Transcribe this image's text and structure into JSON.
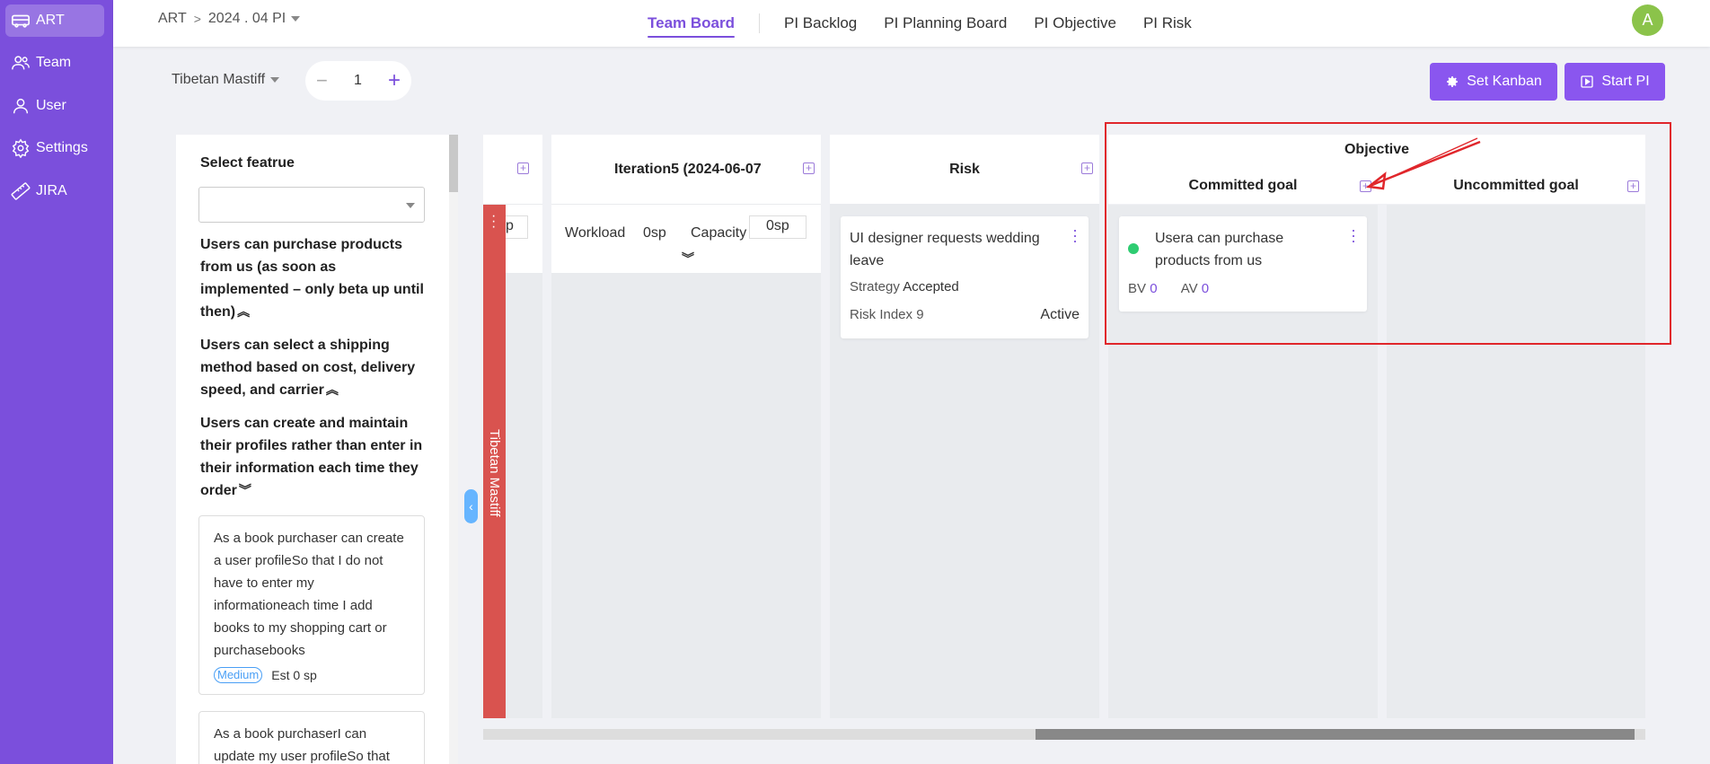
{
  "sidebar": {
    "items": [
      {
        "label": "ART",
        "icon": "bus-icon",
        "active": true
      },
      {
        "label": "Team",
        "icon": "team-icon"
      },
      {
        "label": "User",
        "icon": "user-icon"
      },
      {
        "label": "Settings",
        "icon": "gear-icon"
      },
      {
        "label": "JIRA",
        "icon": "ruler-icon"
      }
    ]
  },
  "header": {
    "breadcrumb_root": "ART",
    "breadcrumb_sep": ">",
    "breadcrumb_pi": "2024 . 04 PI",
    "tabs": [
      {
        "label": "Team Board",
        "active": true
      },
      {
        "label": "PI Backlog"
      },
      {
        "label": "PI Planning Board"
      },
      {
        "label": "PI Objective"
      },
      {
        "label": "PI Risk"
      }
    ],
    "avatar_initial": "A"
  },
  "toolbar": {
    "team": "Tibetan Mastiff",
    "stepper_value": "1",
    "set_kanban_label": "Set Kanban",
    "start_pi_label": "Start PI"
  },
  "features": {
    "select_label": "Select featrue",
    "items": [
      {
        "title": "Users can purchase products from us (as soon as implemented – only beta up until then)",
        "chevron": "︽"
      },
      {
        "title": "Users can select a shipping method based on cost, delivery speed, and carrier",
        "chevron": "︽"
      },
      {
        "title": "Users can create and maintain their profiles rather than enter in their information each time they order",
        "chevron": "︾"
      }
    ],
    "stories": [
      {
        "text": "As a book purchaser can create a user profileSo that I do not have to enter my informationeach time I add books to my shopping cart or purchasebooks",
        "priority": "Medium",
        "estimate": "Est 0 sp"
      },
      {
        "text": "As a book purchaserI can update my user profileSo that"
      }
    ]
  },
  "board": {
    "partial_input": "p",
    "team_band": "Tibetan Mastiff",
    "iteration": {
      "title": "Iteration5 (2024-06-07",
      "workload_label": "Workload",
      "workload_value": "0sp",
      "capacity_label": "Capacity",
      "capacity_value": "0sp"
    },
    "risk": {
      "title": "Risk",
      "card": {
        "title": "UI designer requests wedding leave",
        "strategy_label": "Strategy",
        "strategy_value": "Accepted",
        "risk_index_label": "Risk Index",
        "risk_index_value": "9",
        "status": "Active"
      }
    },
    "objective": {
      "title": "Objective",
      "committed_title": "Committed goal",
      "uncommitted_title": "Uncommitted goal",
      "card": {
        "title": "Usera can purchase products from us",
        "bv_label": "BV",
        "bv_value": "0",
        "av_label": "AV",
        "av_value": "0",
        "status_color": "#2ecc71"
      }
    }
  },
  "colors": {
    "accent": "#7b4fdc",
    "sidebar": "#7b4fdc",
    "team_band": "#d9534f",
    "highlight": "#e0262b"
  }
}
